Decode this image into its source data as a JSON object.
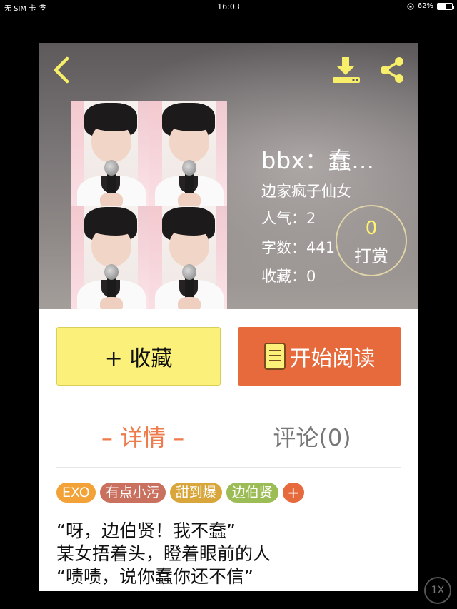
{
  "status_bar": {
    "carrier": "无 SIM 卡",
    "time": "16:03",
    "battery_percent": "62%",
    "battery_level": 0.62
  },
  "header": {
    "back_icon": "chevron-left-icon",
    "download_icon": "download-icon",
    "share_icon": "share-icon",
    "icon_color": "#f7ef6a"
  },
  "book": {
    "title": "bbx：蠢…",
    "author": "边家疯子仙女",
    "popularity_label": "人气：",
    "popularity_value": "2",
    "word_count_label": "字数：",
    "word_count_value": "441",
    "favorites_label": "收藏：",
    "favorites_value": "0"
  },
  "tip": {
    "count": "0",
    "label": "打赏"
  },
  "actions": {
    "collect_label": "+ 收藏",
    "read_label": "开始阅读",
    "read_icon": "book-icon"
  },
  "tabs": {
    "detail_label": "– 详情 –",
    "comments_label": "评论(0)"
  },
  "tags": [
    {
      "label": "EXO",
      "color": "#f2a236"
    },
    {
      "label": "有点小污",
      "color": "#c9705e"
    },
    {
      "label": "甜到爆",
      "color": "#d8a63a"
    },
    {
      "label": "边伯贤",
      "color": "#9cbc56"
    },
    {
      "label": "+",
      "color": "#e76a3c"
    }
  ],
  "synopsis": [
    "“呀，边伯贤！我不蠢”",
    "某女捂着头，瞪着眼前的人",
    "“啧啧，说你蠢你还不信”"
  ],
  "zoom_badge": "1X",
  "colors": {
    "accent_yellow": "#faf07a",
    "accent_orange": "#e76a3c",
    "tab_active": "#ee7b4c"
  }
}
